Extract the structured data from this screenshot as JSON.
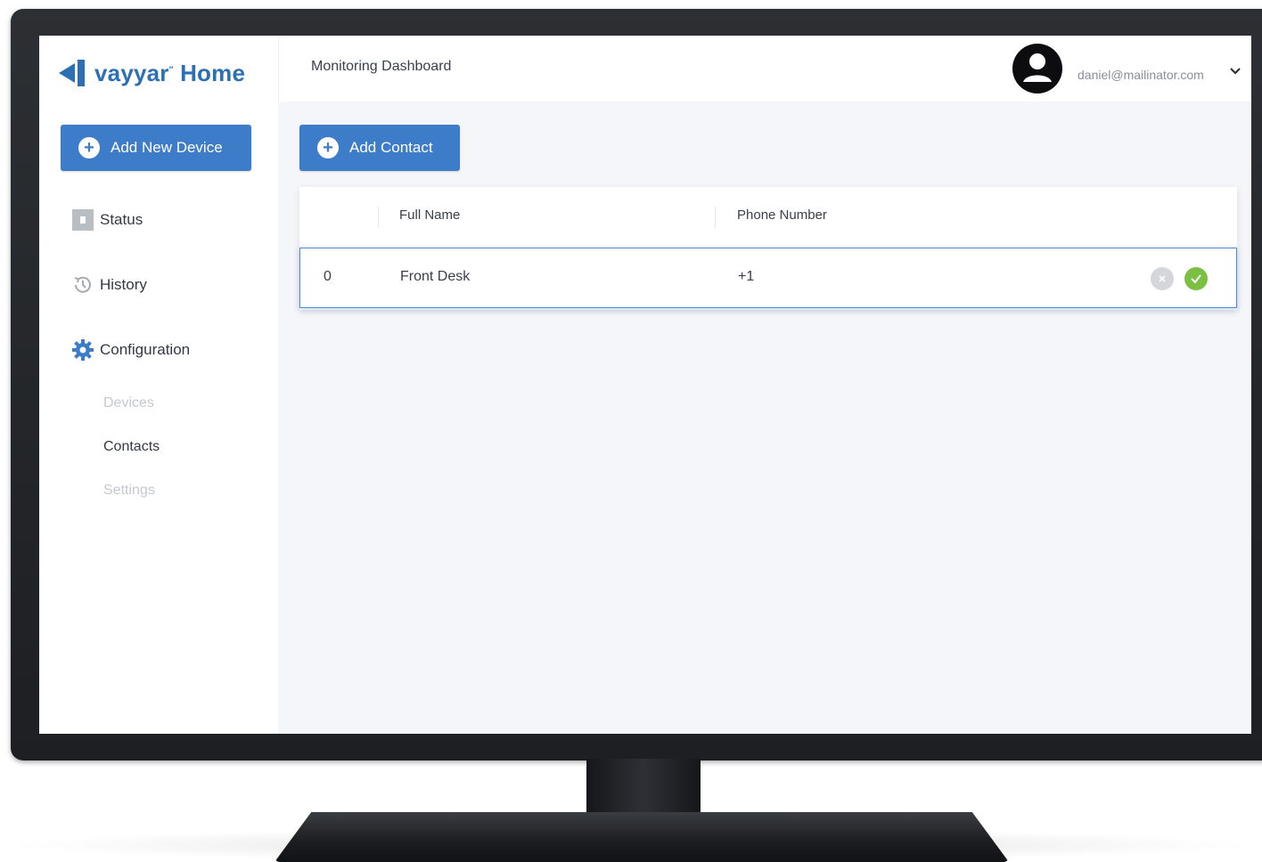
{
  "app": {
    "brand_name": "vayyar",
    "brand_product": "Home",
    "page_title": "Monitoring Dashboard",
    "brand_color": "#2d6fb5",
    "accent_color": "#3d7cc9"
  },
  "user": {
    "email": "daniel@mailinator.com",
    "avatar_icon": "account-circle-icon"
  },
  "sidebar": {
    "add_device_label": "Add New Device",
    "items": [
      {
        "label": "Status",
        "icon": "status-square-icon"
      },
      {
        "label": "History",
        "icon": "history-icon"
      },
      {
        "label": "Configuration",
        "icon": "gear-icon"
      }
    ],
    "sub_items": [
      {
        "label": "Devices",
        "state": "disabled"
      },
      {
        "label": "Contacts",
        "state": "active"
      },
      {
        "label": "Settings",
        "state": "disabled"
      }
    ]
  },
  "main": {
    "add_contact_label": "Add Contact",
    "table": {
      "columns": [
        "",
        "Full Name",
        "Phone Number"
      ],
      "rows": [
        {
          "index": "0",
          "full_name": "Front Desk",
          "phone": "+1"
        }
      ]
    }
  }
}
